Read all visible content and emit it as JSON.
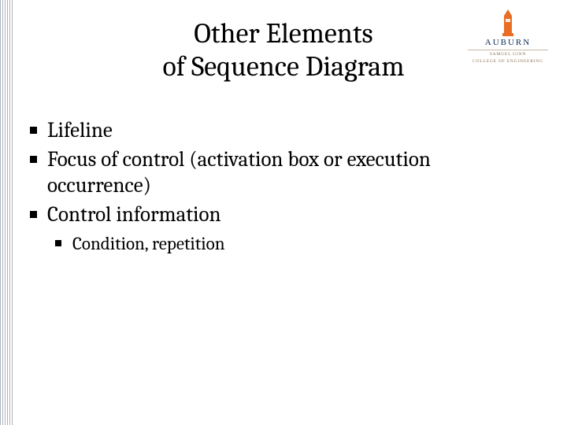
{
  "title": {
    "line1": "Other Elements",
    "line2": "of Sequence Diagram"
  },
  "bullets": {
    "b1": "Lifeline",
    "b2": "Focus of control (activation box or execution occurrence)",
    "b3": "Control information",
    "b3_sub1": "Condition, repetition"
  },
  "logo": {
    "wordmark": "AUBURN",
    "subline1": "SAMUEL GINN",
    "subline2": "COLLEGE OF ENGINEERING"
  },
  "colors": {
    "auburn_orange": "#e86e24",
    "auburn_navy": "#0a2b55"
  }
}
